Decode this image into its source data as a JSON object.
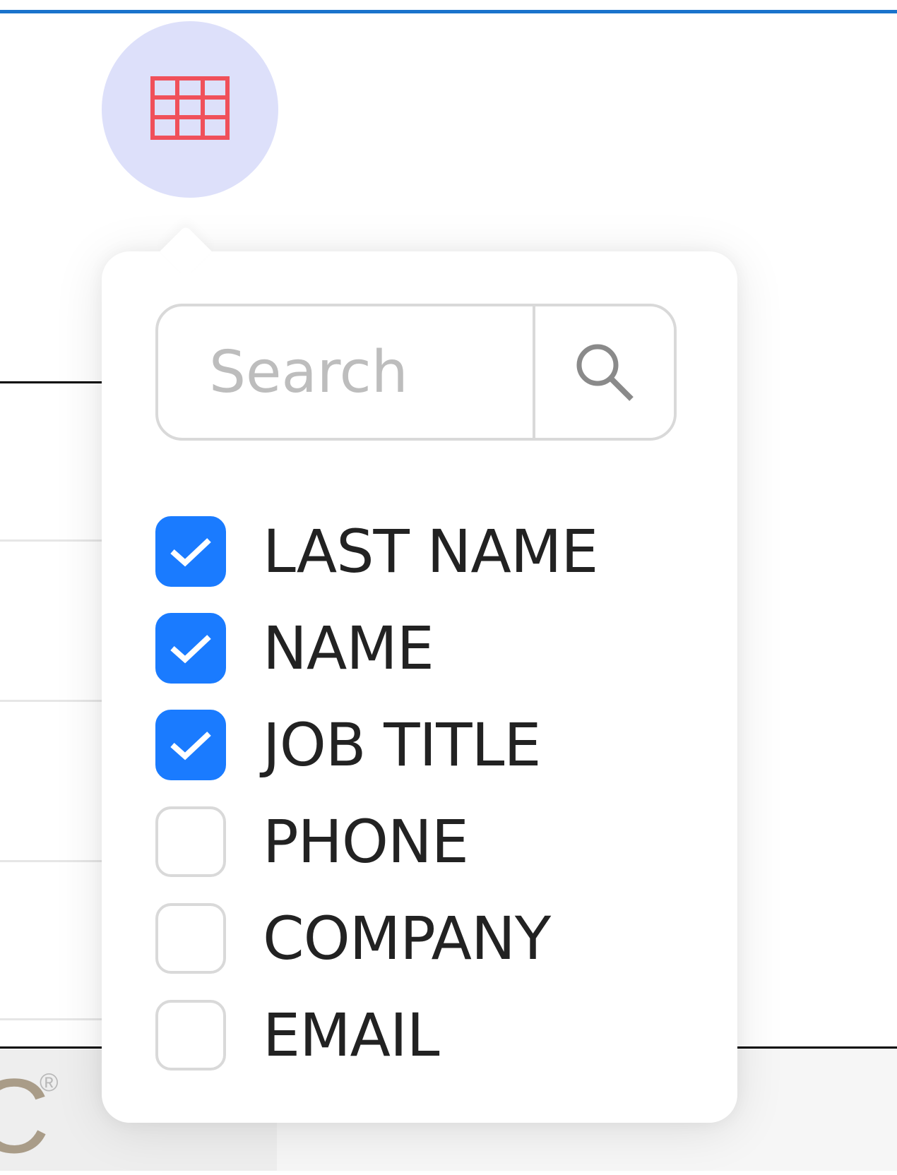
{
  "header": {
    "accent_color": "#1a73cc"
  },
  "columns_toggle": {
    "icon": "table-grid-icon",
    "icon_color": "#f0505a",
    "background": "#dde0fa"
  },
  "search": {
    "placeholder": "Search",
    "value": "",
    "icon": "search-icon"
  },
  "columns": [
    {
      "label": "LAST NAME",
      "checked": true
    },
    {
      "label": "NAME",
      "checked": true
    },
    {
      "label": "JOB TITLE",
      "checked": true
    },
    {
      "label": "PHONE",
      "checked": false
    },
    {
      "label": "COMPANY",
      "checked": false
    },
    {
      "label": "EMAIL",
      "checked": false
    }
  ],
  "checkbox_checked_color": "#1a7bff",
  "background_logo": {
    "text": "C",
    "mark": "®"
  }
}
